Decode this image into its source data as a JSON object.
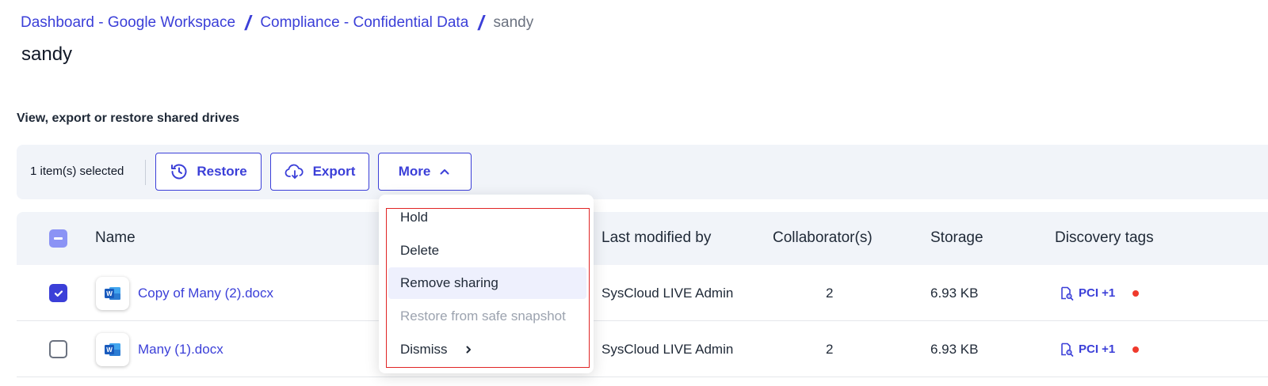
{
  "breadcrumb": {
    "items": [
      "Dashboard - Google Workspace",
      "Compliance - Confidential Data"
    ],
    "separator": "/",
    "current": "sandy"
  },
  "page_title": "sandy",
  "subtitle": "View, export or restore shared drives",
  "toolbar": {
    "selection_count": "1 item(s) selected",
    "restore_label": "Restore",
    "export_label": "Export",
    "more_label": "More"
  },
  "table": {
    "columns": [
      "Name",
      "Last modified by",
      "Collaborator(s)",
      "Storage",
      "Discovery tags"
    ],
    "rows": [
      {
        "checked": true,
        "name": "Copy of Many (2).docx",
        "modified_by": "SysCloud LIVE Admin",
        "collaborators": "2",
        "storage": "6.93 KB",
        "tags": "PCI +1"
      },
      {
        "checked": false,
        "name": "Many (1).docx",
        "modified_by": "SysCloud LIVE Admin",
        "collaborators": "2",
        "storage": "6.93 KB",
        "tags": "PCI +1"
      }
    ]
  },
  "more_menu": {
    "items": [
      {
        "label": "Hold",
        "state": "normal"
      },
      {
        "label": "Delete",
        "state": "normal"
      },
      {
        "label": "Remove sharing",
        "state": "hovered"
      },
      {
        "label": "Restore from safe snapshot",
        "state": "disabled"
      },
      {
        "label": "Dismiss",
        "state": "submenu"
      }
    ]
  },
  "colors": {
    "accent": "#3b3fd8",
    "toolbar_bg": "#f1f4f9",
    "highlight_border": "#e02424",
    "status_dot": "#ef3a2c",
    "word_icon": "#185abd"
  },
  "icons": [
    "history-icon",
    "cloud-download-icon",
    "chevron-up-icon",
    "check-icon",
    "word-file-icon",
    "document-search-icon",
    "chevron-right-icon"
  ]
}
